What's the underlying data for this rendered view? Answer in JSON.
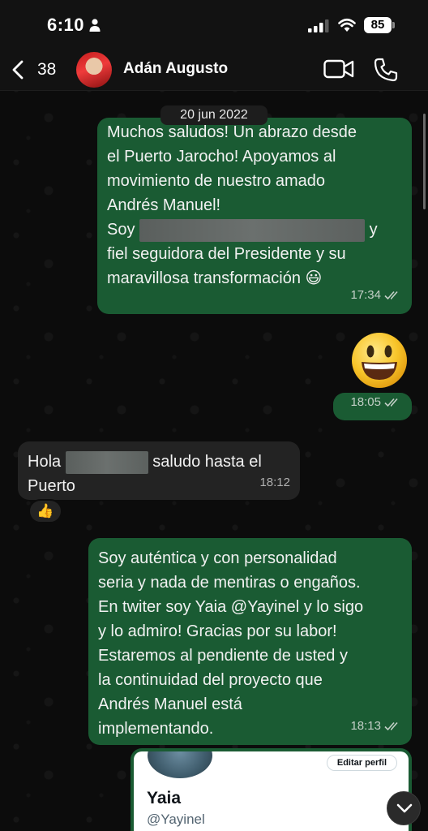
{
  "status_bar": {
    "time": "6:10",
    "battery": "85"
  },
  "header": {
    "back_count": "38",
    "contact_name": "Adán Augusto"
  },
  "date_chip": "20 jun 2022",
  "messages": [
    {
      "direction": "outgoing",
      "lines": [
        "Muchos saludos! Un abrazo desde",
        "el Puerto Jarocho! Apoyamos al",
        "movimiento de nuestro amado",
        "Andrés Manuel!"
      ],
      "line5_prefix": "Soy",
      "line5_suffix": "y",
      "line6": "fiel seguidora del Presidente y su",
      "line7": "maravillosa transformación 😃",
      "time": "17:34"
    },
    {
      "direction": "outgoing",
      "emoji": "😃",
      "time": "18:05"
    },
    {
      "direction": "incoming",
      "prefix": "Hola",
      "suffix": "saludo hasta el",
      "line2": "Puerto",
      "time": "18:12",
      "reaction": "👍"
    },
    {
      "direction": "outgoing",
      "text": "Soy auténtica y con personalidad\nseria y nada de mentiras o engaños.\nEn twiter soy Yaia @Yayinel y lo sigo\ny lo admiro! Gracias por su labor!\nEstaremos al pendiente de usted y\nla continuidad del proyecto que\nAndrés Manuel está\nimplementando.",
      "time": "18:13"
    }
  ],
  "profile_card": {
    "edit_button": "Editar perfil",
    "name": "Yaia",
    "handle": "@Yayinel"
  },
  "colors": {
    "outgoing_bubble": "#1a5b33",
    "incoming_bubble": "#232323",
    "background": "#0c0c0c"
  }
}
